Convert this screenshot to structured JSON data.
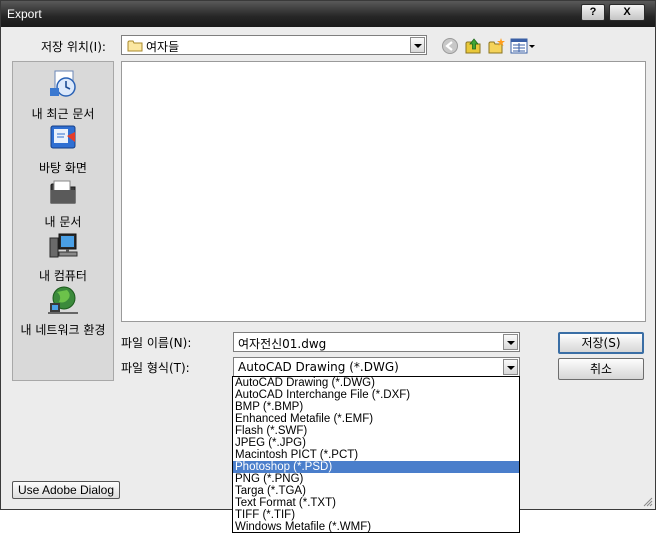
{
  "window": {
    "title": "Export",
    "help_label": "?",
    "close_label": "X"
  },
  "lookin": {
    "label": "저장 위치(I):",
    "value": "여자들"
  },
  "places": [
    {
      "label": "내 최근 문서",
      "icon": "recent-documents-icon"
    },
    {
      "label": "바탕 화면",
      "icon": "desktop-icon"
    },
    {
      "label": "내 문서",
      "icon": "my-documents-icon"
    },
    {
      "label": "내 컴퓨터",
      "icon": "my-computer-icon"
    },
    {
      "label": "내 네트워크 환경",
      "icon": "network-places-icon"
    }
  ],
  "filename": {
    "label": "파일 이름(N):",
    "value": "여자전신01.dwg"
  },
  "filetype": {
    "label": "파일 형식(T):",
    "value": "AutoCAD Drawing (*.DWG)",
    "options": [
      "AutoCAD Drawing (*.DWG)",
      "AutoCAD Interchange File (*.DXF)",
      "BMP (*.BMP)",
      "Enhanced Metafile (*.EMF)",
      "Flash (*.SWF)",
      "JPEG (*.JPG)",
      "Macintosh PICT (*.PCT)",
      "Photoshop (*.PSD)",
      "PNG (*.PNG)",
      "Targa (*.TGA)",
      "Text Format (*.TXT)",
      "TIFF (*.TIF)",
      "Windows Metafile (*.WMF)"
    ],
    "selected_index": 7
  },
  "buttons": {
    "save": "저장(S)",
    "cancel": "취소",
    "adobe": "Use Adobe Dialog"
  }
}
